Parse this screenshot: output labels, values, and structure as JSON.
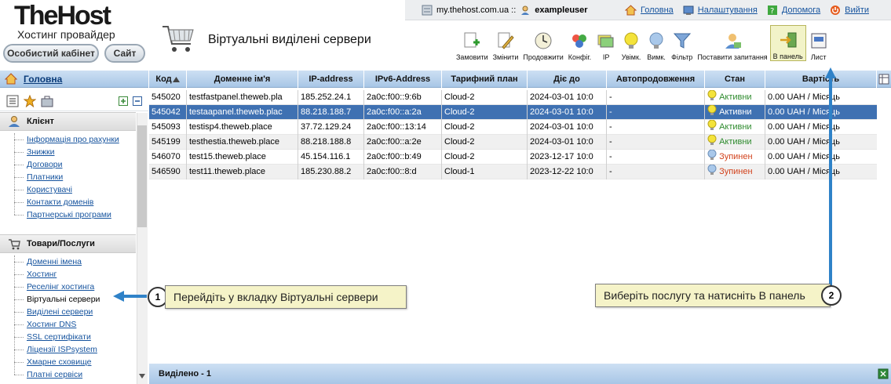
{
  "header": {
    "logo": "TheHost",
    "subtitle": "Хостинг провайдер",
    "cabinet_btn": "Особистий кабінет",
    "site_btn": "Сайт",
    "page_title": "Віртуальні виділені сервери"
  },
  "topbar": {
    "host": "my.thehost.com.ua ::",
    "user": "exampleuser",
    "links": [
      "Головна",
      "Налаштування",
      "Допомога",
      "Вийти"
    ]
  },
  "toolbar": [
    "Замовити",
    "Змінити",
    "Продовжити",
    "Конфіг.",
    "IP",
    "Увімк.",
    "Вимк.",
    "Фільтр",
    "Поставити запитання",
    "В панель",
    "Лист"
  ],
  "sidebar": {
    "home": "Головна",
    "client": {
      "title": "Клієнт",
      "items": [
        "Інформація про рахунки",
        "Знижки",
        "Договори",
        "Платники",
        "Користувачі",
        "Контакти доменів",
        "Партнерські програми"
      ]
    },
    "products": {
      "title": "Товари/Послуги",
      "items": [
        "Доменні імена",
        "Хостинг",
        "Реселінг хостинга",
        "Віртуальні сервери",
        "Виділені сервери",
        "Хостинг DNS",
        "SSL сертифікати",
        "Ліцензії ISPsystem",
        "Хмарне сховище",
        "Платні сервіси"
      ]
    }
  },
  "table": {
    "columns": [
      "Код",
      "Доменне ім'я",
      "IP-address",
      "IPv6-Address",
      "Тарифний план",
      "Діє до",
      "Автопродовження",
      "Стан",
      "Вартість"
    ],
    "rows": [
      [
        "545020",
        "testfastpanel.theweb.pla",
        "185.252.24.1",
        "2a0c:f00::9:6b",
        "Cloud-2",
        "2024-03-01 10:0",
        "-",
        "Активни",
        "0.00 UAH / Місяць"
      ],
      [
        "545042",
        "testaapanel.theweb.plac",
        "88.218.188.7",
        "2a0c:f00::a:2a",
        "Cloud-2",
        "2024-03-01 10:0",
        "-",
        "Активни",
        "0.00 UAH / Місяць"
      ],
      [
        "545093",
        "testisp4.theweb.place",
        "37.72.129.24",
        "2a0c:f00::13:14",
        "Cloud-2",
        "2024-03-01 10:0",
        "-",
        "Активни",
        "0.00 UAH / Місяць"
      ],
      [
        "545199",
        "testhestia.theweb.place",
        "88.218.188.8",
        "2a0c:f00::a:2e",
        "Cloud-2",
        "2024-03-01 10:0",
        "-",
        "Активни",
        "0.00 UAH / Місяць"
      ],
      [
        "546070",
        "test15.theweb.place",
        "45.154.116.1",
        "2a0c:f00::b:49",
        "Cloud-2",
        "2023-12-17 10:0",
        "-",
        "Зупинен",
        "0.00 UAH / Місяць"
      ],
      [
        "546590",
        "test11.theweb.place",
        "185.230.88.2",
        "2a0c:f00::8:d",
        "Cloud-1",
        "2023-12-22 10:0",
        "-",
        "Зупинен",
        "0.00 UAH / Місяць"
      ]
    ],
    "footer": "Виділено - 1"
  },
  "callouts": {
    "one": {
      "num": "1",
      "text": "Перейдіть у вкладку Віртуальні сервери"
    },
    "two": {
      "num": "2",
      "text": "Виберіть послугу та натисніть В панель"
    }
  }
}
